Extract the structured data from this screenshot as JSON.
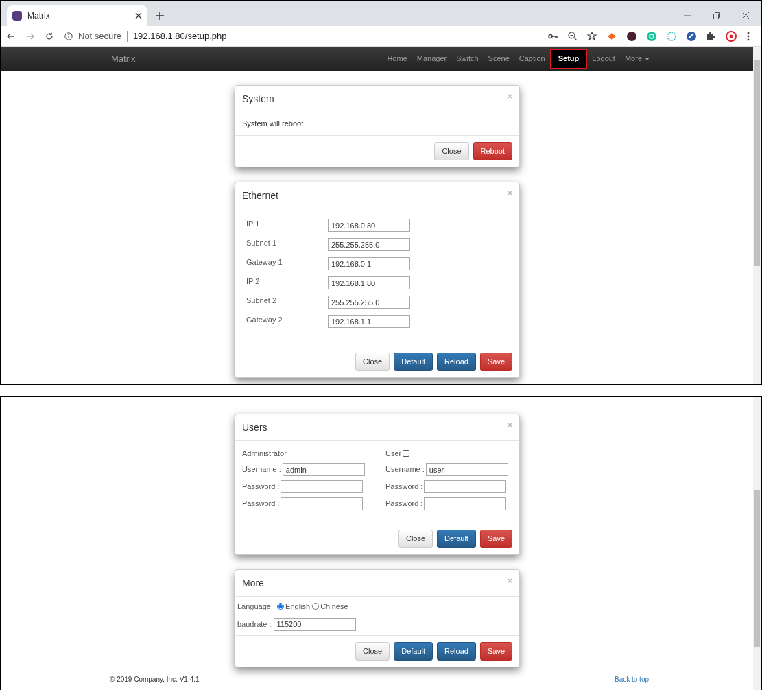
{
  "browser": {
    "tab_title": "Matrix",
    "security": "Not secure",
    "url": "192.168.1.80/setup.php"
  },
  "navbar": {
    "brand": "Matrix",
    "items": [
      {
        "label": "Home",
        "selected": false,
        "kind": "link"
      },
      {
        "label": "Manager",
        "selected": false,
        "kind": "link"
      },
      {
        "label": "Switch",
        "selected": false,
        "kind": "link"
      },
      {
        "label": "Scene",
        "selected": false,
        "kind": "link"
      },
      {
        "label": "Caption",
        "selected": false,
        "kind": "link"
      },
      {
        "label": "Setup",
        "selected": true,
        "kind": "link"
      },
      {
        "label": "Logout",
        "selected": false,
        "kind": "link"
      },
      {
        "label": "More",
        "selected": false,
        "kind": "dropdown"
      }
    ]
  },
  "top_screen": {
    "modals": [
      {
        "kind": "message",
        "title": "System",
        "message": "System will reboot",
        "buttons": [
          {
            "label": "Close",
            "kind": "default"
          },
          {
            "label": "Reboot",
            "kind": "danger"
          }
        ]
      },
      {
        "kind": "form",
        "title": "Ethernet",
        "fields": [
          {
            "label": "IP 1",
            "value": "192.168.0.80"
          },
          {
            "label": "Subnet 1",
            "value": "255.255.255.0"
          },
          {
            "label": "Gateway 1",
            "value": "192.168.0.1"
          },
          {
            "label": "IP 2",
            "value": "192.168.1.80"
          },
          {
            "label": "Subnet 2",
            "value": "255.255.255.0"
          },
          {
            "label": "Gateway 2",
            "value": "192.168.1.1"
          }
        ],
        "buttons": [
          {
            "label": "Close",
            "kind": "default"
          },
          {
            "label": "Default",
            "kind": "primary"
          },
          {
            "label": "Reload",
            "kind": "primary"
          },
          {
            "label": "Save",
            "kind": "danger"
          }
        ]
      }
    ]
  },
  "bottom_screen": {
    "modals": [
      {
        "kind": "users",
        "title": "Users",
        "columns": [
          {
            "heading": "Administrator",
            "fields": [
              {
                "label": "Username :",
                "value": "admin"
              },
              {
                "label": "Password :"
              },
              {
                "label": "Password :"
              }
            ]
          },
          {
            "heading": "User",
            "checked": false,
            "fields": [
              {
                "label": "Username :",
                "value": "user"
              },
              {
                "label": "Password :"
              },
              {
                "label": "Password :"
              }
            ]
          }
        ],
        "buttons": [
          {
            "label": "Close",
            "kind": "default"
          },
          {
            "label": "Default",
            "kind": "primary"
          },
          {
            "label": "Save",
            "kind": "danger"
          }
        ]
      },
      {
        "kind": "options",
        "title": "More",
        "language": {
          "label": "Language :",
          "options": [
            {
              "label": "English",
              "selected": true
            },
            {
              "label": "Chinese",
              "selected": false
            }
          ]
        },
        "baudrate": {
          "label": "baudrate :",
          "value": "115200"
        },
        "buttons": [
          {
            "label": "Close",
            "kind": "default"
          },
          {
            "label": "Default",
            "kind": "primary"
          },
          {
            "label": "Reload",
            "kind": "primary"
          },
          {
            "label": "Save",
            "kind": "danger"
          }
        ]
      }
    ],
    "footer": {
      "copyright": "© 2019 Company, Inc. V1.4.1",
      "back_to_top": "Back to top"
    }
  }
}
